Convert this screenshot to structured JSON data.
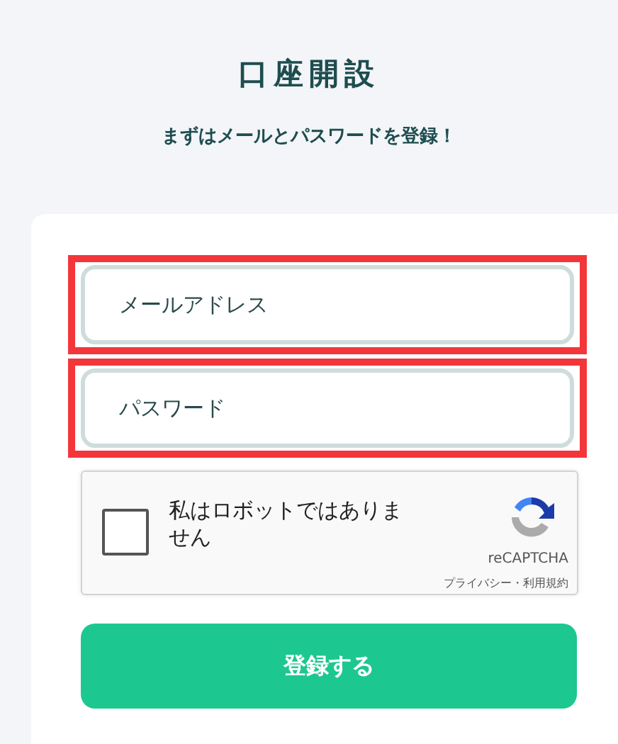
{
  "title": "口座開設",
  "subtitle": "まずはメールとパスワードを登録！",
  "fields": [
    {
      "placeholder": "メールアドレス",
      "highlighted": true
    },
    {
      "placeholder": "パスワード",
      "highlighted": true
    }
  ],
  "captcha": {
    "label": "私はロボットではありません",
    "checked": false,
    "brand": "reCAPTCHA",
    "links": "プライバシー・利用規約"
  },
  "submit_button": "登録する"
}
